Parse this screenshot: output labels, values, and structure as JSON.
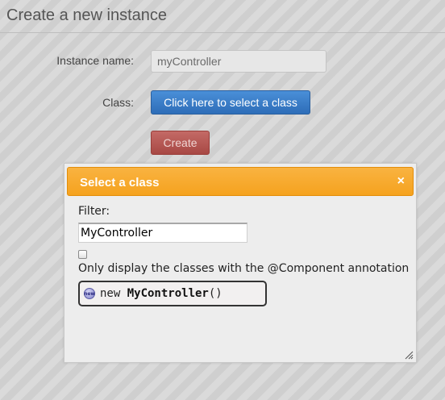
{
  "page": {
    "title": "Create a new instance"
  },
  "form": {
    "instance_name_label": "Instance name:",
    "instance_name_value": "myController",
    "class_label": "Class:",
    "select_class_button": "Click here to select a class",
    "create_button": "Create"
  },
  "dialog": {
    "title": "Select a class",
    "close_glyph": "×",
    "filter_label": "Filter:",
    "filter_value": "MyController",
    "component_only_checked": false,
    "component_only_label": "Only display the classes with the @Component annotation",
    "results": [
      {
        "icon": "class-icon",
        "prefix": "new ",
        "name": "MyController",
        "suffix": "()"
      }
    ]
  },
  "colors": {
    "dialog_header": "#f5a21e",
    "primary_button": "#3a7dc8",
    "danger_button": "#b6534f"
  }
}
